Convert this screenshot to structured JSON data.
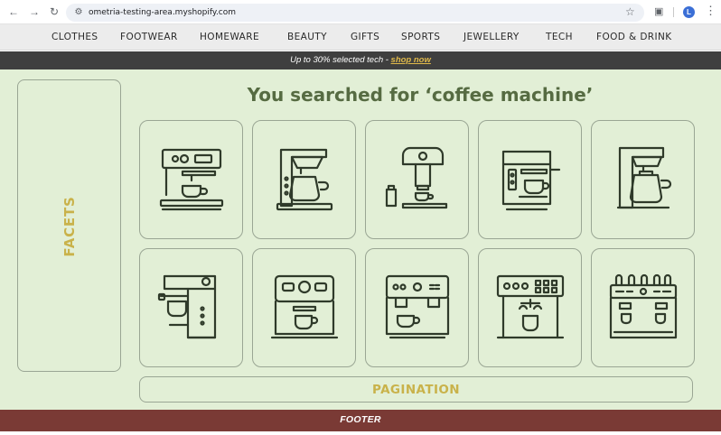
{
  "browser": {
    "url": "ometria-testing-area.myshopify.com",
    "avatar_initial": "L",
    "icons": [
      "back-arrow-icon",
      "forward-arrow-icon",
      "reload-icon",
      "site-settings-icon",
      "bookmark-star-icon",
      "extensions-icon",
      "profile-avatar",
      "kebab-menu-icon"
    ]
  },
  "nav": {
    "categories": [
      "CLOTHES",
      "FOOTWEAR",
      "HOMEWARE",
      "BEAUTY",
      "GIFTS",
      "SPORTS",
      "JEWELLERY",
      "TECH",
      "FOOD & DRINK"
    ]
  },
  "promo": {
    "text": "Up to 30% selected tech - ",
    "link": "shop now"
  },
  "facets": {
    "label": "FACETS"
  },
  "search": {
    "heading": "You searched for ‘coffee machine’"
  },
  "products": [
    {
      "icon": "espresso-machine-icon"
    },
    {
      "icon": "drip-coffee-maker-icon"
    },
    {
      "icon": "pod-coffee-machine-icon"
    },
    {
      "icon": "compact-espresso-icon"
    },
    {
      "icon": "filter-coffee-maker-icon"
    },
    {
      "icon": "tall-espresso-machine-icon"
    },
    {
      "icon": "dial-espresso-machine-icon"
    },
    {
      "icon": "double-espresso-machine-icon"
    },
    {
      "icon": "commercial-coffee-machine-icon"
    },
    {
      "icon": "three-group-espresso-machine-icon"
    }
  ],
  "pagination": {
    "label": "PAGINATION"
  },
  "footer": {
    "label": "FOOTER"
  },
  "colors": {
    "background": "#e2efd6",
    "heading": "#566b42",
    "placeholder_label": "#c9b24a",
    "footer": "#7a3a35",
    "promo_bar": "#3f3f3f",
    "promo_link": "#e0b94a"
  }
}
